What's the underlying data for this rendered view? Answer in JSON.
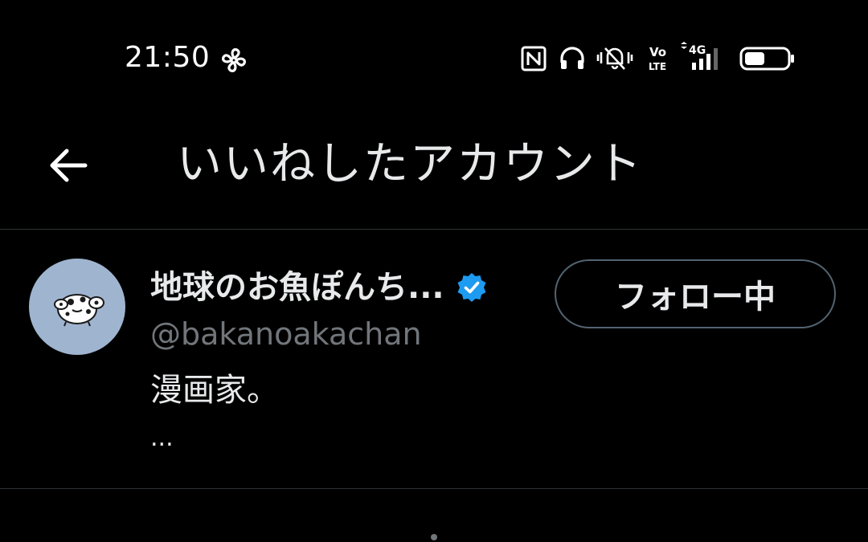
{
  "status_bar": {
    "time": "21:50",
    "icons": [
      "pinwheel-icon",
      "nfc-icon",
      "headphones-icon",
      "vibrate-mute-icon",
      "volte-icon",
      "4g-signal-icon",
      "battery-icon"
    ],
    "volte_label_top": "Vo",
    "volte_label_bottom": "LTE",
    "network_label": "4G"
  },
  "header": {
    "back_icon": "arrow-left-icon",
    "title": "いいねしたアカウント"
  },
  "accounts": [
    {
      "display_name": "地球のお魚ぽんち...",
      "verified": true,
      "handle": "@bakanoakachan",
      "bio": "漫画家。",
      "bio_more": "...",
      "follow_label": "フォロー中"
    }
  ],
  "colors": {
    "background": "#000000",
    "primary_text": "#e7e9ea",
    "secondary_text": "#71767b",
    "divider": "#2f3336",
    "verified_blue": "#1d9bf0",
    "avatar_bg": "#9fb4cf"
  }
}
